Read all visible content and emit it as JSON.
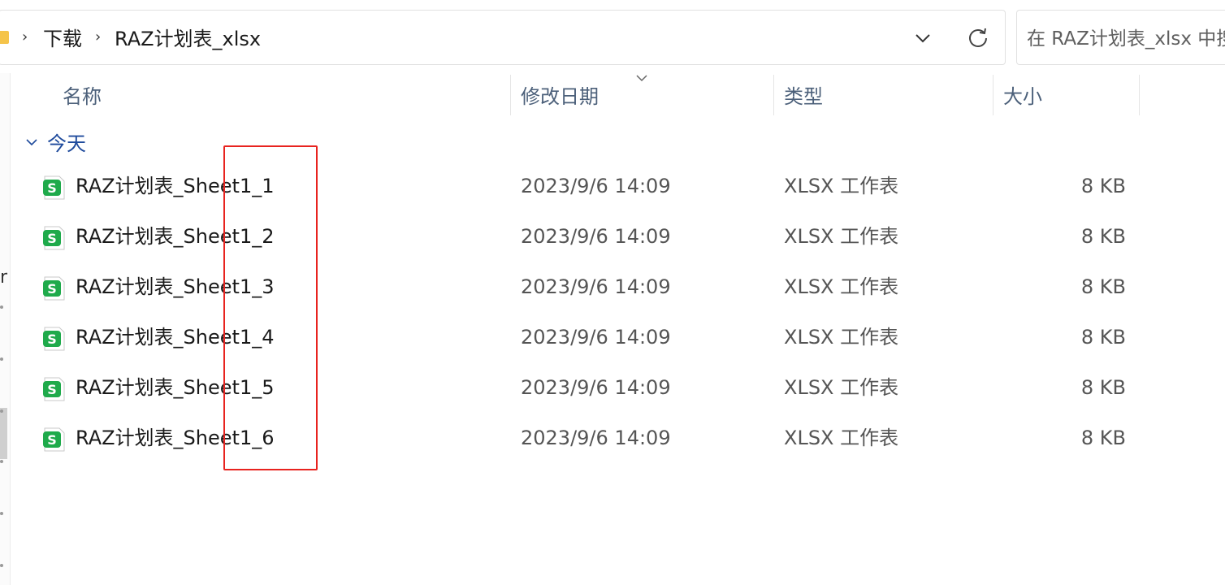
{
  "breadcrumb": {
    "items": [
      "下载",
      "RAZ计划表_xlsx"
    ],
    "separator": "›"
  },
  "search": {
    "placeholder": "在 RAZ计划表_xlsx 中搜"
  },
  "nav": {
    "partial_letter": "r"
  },
  "columns": {
    "name": "名称",
    "date": "修改日期",
    "type": "类型",
    "size": "大小"
  },
  "group": {
    "label": "今天"
  },
  "files": [
    {
      "name": "RAZ计划表_Sheet1_1",
      "date": "2023/9/6 14:09",
      "type": "XLSX 工作表",
      "size": "8 KB"
    },
    {
      "name": "RAZ计划表_Sheet1_2",
      "date": "2023/9/6 14:09",
      "type": "XLSX 工作表",
      "size": "8 KB"
    },
    {
      "name": "RAZ计划表_Sheet1_3",
      "date": "2023/9/6 14:09",
      "type": "XLSX 工作表",
      "size": "8 KB"
    },
    {
      "name": "RAZ计划表_Sheet1_4",
      "date": "2023/9/6 14:09",
      "type": "XLSX 工作表",
      "size": "8 KB"
    },
    {
      "name": "RAZ计划表_Sheet1_5",
      "date": "2023/9/6 14:09",
      "type": "XLSX 工作表",
      "size": "8 KB"
    },
    {
      "name": "RAZ计划表_Sheet1_6",
      "date": "2023/9/6 14:09",
      "type": "XLSX 工作表",
      "size": "8 KB"
    }
  ],
  "icons": {
    "folder": "folder-icon",
    "dropdown": "chevron-down-icon",
    "refresh": "refresh-icon",
    "file": "spreadsheet-file-icon"
  },
  "colors": {
    "highlight": "#e8231f",
    "group_label": "#1e4a9c",
    "header_text": "#4c607a",
    "xlsx_icon": "#1faa4b"
  }
}
